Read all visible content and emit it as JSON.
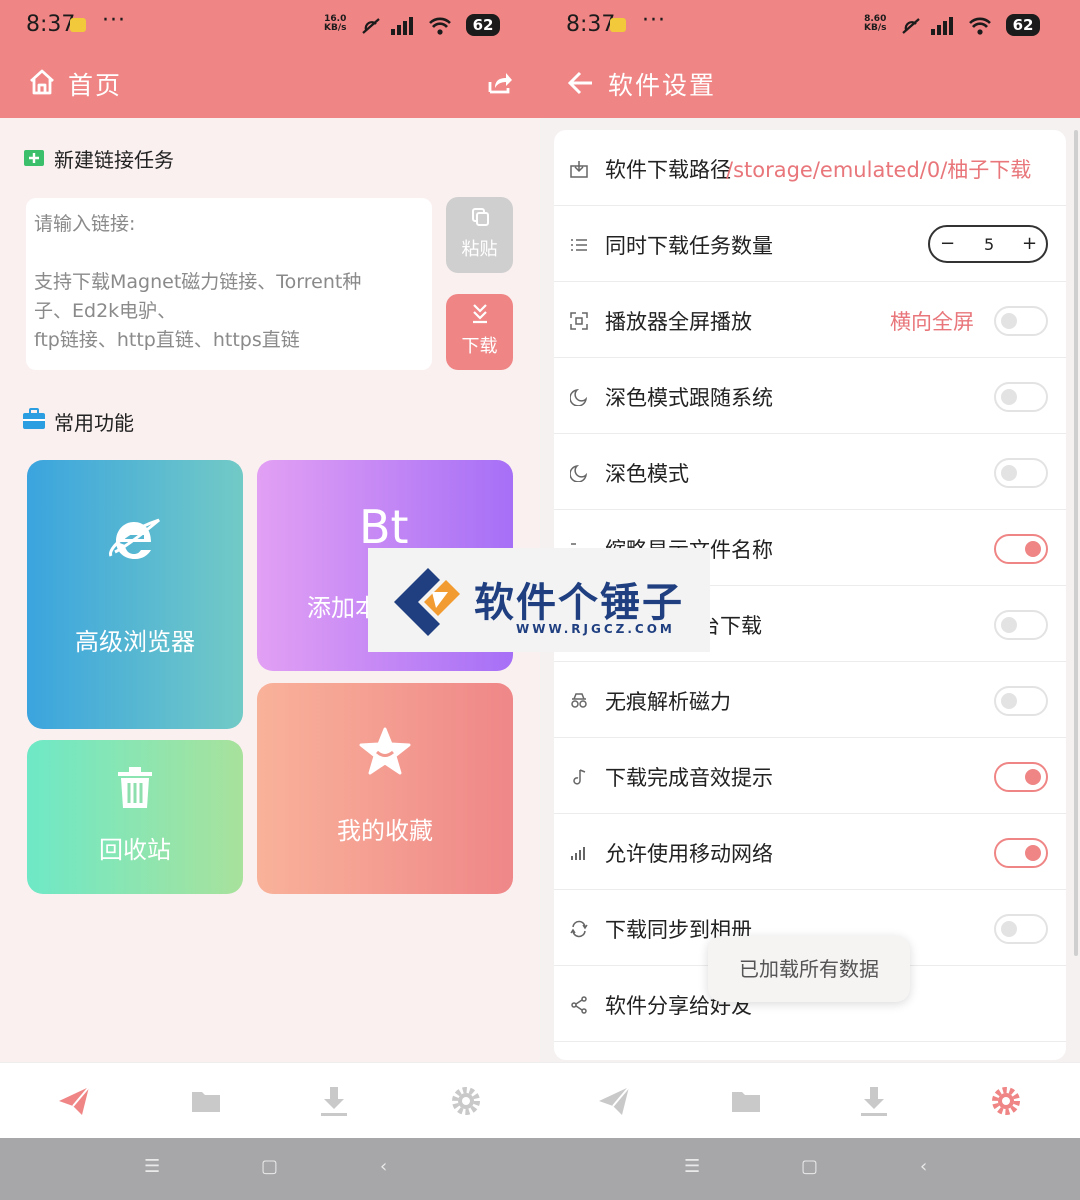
{
  "left": {
    "status": {
      "time": "8:37",
      "dots": "···",
      "speed_value": "16.0",
      "speed_unit": "KB/s",
      "battery": "62"
    },
    "appbar": {
      "title": "首页"
    },
    "new_task": {
      "title": "新建链接任务",
      "placeholder": "请输入链接:\n\n支持下载Magnet磁力链接、Torrent种\n子、Ed2k电驴、\nftp链接、http直链、https直链",
      "paste_label": "粘贴",
      "download_label": "下载"
    },
    "functions": {
      "title": "常用功能",
      "browser_label": "高级浏览器",
      "bt_label": "添加本",
      "bt_icon_text": "Bt",
      "recycle_label": "回收站",
      "favorite_label": "我的收藏"
    }
  },
  "right": {
    "status": {
      "time": "8:37",
      "dots": "···",
      "speed_value": "8.60",
      "speed_unit": "KB/s",
      "battery": "62"
    },
    "appbar": {
      "title": "软件设置"
    },
    "settings": [
      {
        "label": "软件下载路径",
        "value": "/storage/emulated/0/柚子下载"
      },
      {
        "label": "同时下载任务数量",
        "value": "5"
      },
      {
        "label": "播放器全屏播放",
        "value": "横向全屏",
        "on": false
      },
      {
        "label": "深色模式跟随系统",
        "on": false
      },
      {
        "label": "深色模式",
        "on": false
      },
      {
        "label": "缩略显示文件名称",
        "on": true
      },
      {
        "label": "台下载",
        "on": false
      },
      {
        "label": "无痕解析磁力",
        "on": false
      },
      {
        "label": "下载完成音效提示",
        "on": true
      },
      {
        "label": "允许使用移动网络",
        "on": true
      },
      {
        "label": "下载同步到相册",
        "on": false
      },
      {
        "label": "软件分享给好友"
      }
    ],
    "toast": "已加载所有数据"
  },
  "watermark": {
    "text": "软件个锤子",
    "url": "WWW.RJGCZ.COM"
  },
  "colors": {
    "accent": "#ef8585",
    "nav_inactive": "#c9c9c9",
    "toggle_off": "#e3e3e3"
  }
}
